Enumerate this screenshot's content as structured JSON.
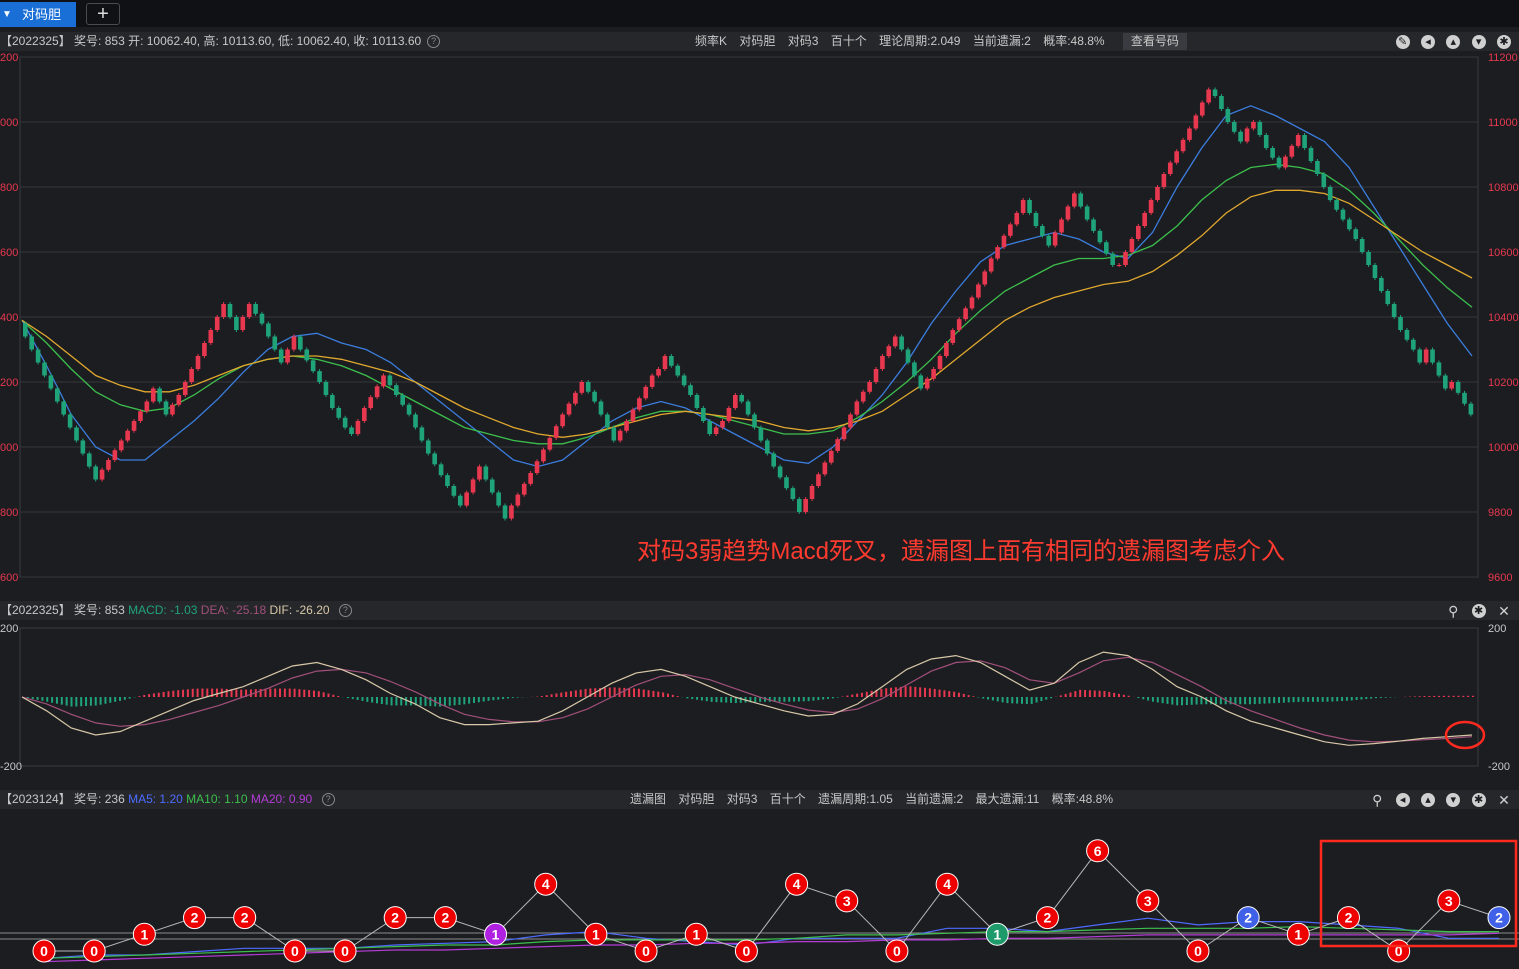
{
  "tabs": {
    "active_label": "对码胆",
    "add_label": "+"
  },
  "main_header": {
    "info": "【2022325】 奖号: 853   开: 10062.40, 高: 10113.60, 低: 10062.40, 收: 10113.60",
    "items": [
      "频率K",
      "对码胆",
      "对码3",
      "百十个",
      "理论周期:2.049",
      "当前遗漏:2",
      "概率:48.8%"
    ],
    "view_button": "查看号码"
  },
  "annotation": "对码3弱趋势Macd死叉，遗漏图上面有相同的遗漏图考虑介入",
  "macd_header": {
    "info": "【2022325】 奖号: 853",
    "macd": "MACD: -1.03",
    "dea": "DEA: -25.18",
    "dif": "DIF: -26.20"
  },
  "omit_header": {
    "info": "【2023124】 奖号: 236",
    "ma5": "MA5: 1.20",
    "ma10": "MA10: 1.10",
    "ma20": "MA20: 0.90",
    "items": [
      "遗漏图",
      "对码胆",
      "对码3",
      "百十个",
      "遗漏周期:1.05",
      "当前遗漏:2",
      "最大遗漏:11",
      "概率:48.8%"
    ]
  },
  "colors": {
    "up": "#e8384f",
    "down": "#1fa47a",
    "ma_fast": "#3b7ddd",
    "ma_mid": "#3cbf4c",
    "ma_slow": "#e0a82e",
    "dif": "#d8c8a8",
    "dea": "#a0507a",
    "note": "#ff3b2f"
  },
  "chart_data": [
    {
      "type": "candlestick",
      "title": "",
      "ylim": [
        9600,
        11200
      ],
      "yticks_right": [
        "11200",
        "11000",
        "10800",
        "10600",
        "10400",
        "10200",
        "10000",
        "9800",
        "9600"
      ],
      "yticks_left": [
        "200",
        "000",
        "800",
        "600",
        "400",
        "200",
        "000",
        "800",
        "600"
      ],
      "ohlc_last": {
        "open": 10062.4,
        "high": 10113.6,
        "low": 10062.4,
        "close": 10113.6
      },
      "brick": 40,
      "path": [
        10380,
        10300,
        10180,
        10060,
        9940,
        9900,
        9960,
        10020,
        10080,
        10140,
        10180,
        10100,
        10160,
        10240,
        10320,
        10400,
        10440,
        10360,
        10400,
        10440,
        10380,
        10300,
        10260,
        10340,
        10300,
        10200,
        10120,
        10060,
        10040,
        10120,
        10220,
        10160,
        10100,
        9980,
        9880,
        9820,
        9860,
        9940,
        9900,
        9780,
        9820,
        9920,
        10100,
        10200,
        10140,
        10020,
        10080,
        10220,
        10240,
        10280,
        10220,
        10160,
        10080,
        10040,
        10060,
        10080,
        10160,
        10140,
        10060,
        9940,
        9840,
        9800,
        9880,
        10060,
        10140,
        10200,
        10280,
        10340,
        10300,
        10180,
        10240,
        10360,
        10460,
        10580,
        10720,
        10760,
        10680,
        10620,
        10740,
        10780,
        10700,
        10560,
        10560,
        10640,
        10840,
        10980,
        11060,
        11100,
        11080,
        11000,
        10940,
        10980,
        11000,
        10920,
        10860,
        10960,
        10920,
        10840,
        10760,
        10700,
        10640,
        10560,
        10440,
        10360,
        10300,
        10260,
        10300,
        10260,
        10220,
        10180,
        10200,
        10100
      ],
      "series": [
        {
          "name": "",
          "color": "#3b7ddd",
          "values": [
            10390,
            10250,
            10100,
            10000,
            9960,
            9960,
            10020,
            10080,
            10150,
            10230,
            10300,
            10340,
            10350,
            10320,
            10300,
            10260,
            10200,
            10140,
            10080,
            10020,
            9960,
            9940,
            9960,
            10020,
            10080,
            10120,
            10140,
            10120,
            10080,
            10040,
            10000,
            9960,
            9950,
            10000,
            10080,
            10160,
            10260,
            10380,
            10480,
            10570,
            10620,
            10640,
            10660,
            10640,
            10600,
            10580,
            10660,
            10800,
            10920,
            11020,
            11050,
            11020,
            10980,
            10940,
            10860,
            10740,
            10620,
            10500,
            10380,
            10280
          ]
        },
        {
          "name": "",
          "color": "#3cbf4c",
          "values": [
            10390,
            10320,
            10240,
            10170,
            10130,
            10110,
            10120,
            10160,
            10210,
            10250,
            10270,
            10280,
            10270,
            10250,
            10220,
            10180,
            10140,
            10100,
            10060,
            10040,
            10020,
            10010,
            10010,
            10030,
            10060,
            10090,
            10110,
            10110,
            10100,
            10080,
            10060,
            10040,
            10040,
            10050,
            10090,
            10140,
            10200,
            10270,
            10350,
            10420,
            10480,
            10520,
            10560,
            10580,
            10580,
            10590,
            10620,
            10680,
            10760,
            10820,
            10860,
            10870,
            10860,
            10840,
            10790,
            10720,
            10640,
            10560,
            10490,
            10430
          ]
        },
        {
          "name": "",
          "color": "#e0a82e",
          "values": [
            10390,
            10340,
            10280,
            10220,
            10190,
            10170,
            10170,
            10190,
            10220,
            10250,
            10270,
            10280,
            10280,
            10270,
            10250,
            10230,
            10200,
            10160,
            10120,
            10090,
            10060,
            10040,
            10030,
            10040,
            10060,
            10080,
            10100,
            10110,
            10100,
            10090,
            10080,
            10060,
            10050,
            10060,
            10080,
            10110,
            10160,
            10210,
            10270,
            10330,
            10390,
            10430,
            10460,
            10480,
            10500,
            10510,
            10540,
            10590,
            10650,
            10720,
            10770,
            10790,
            10790,
            10780,
            10750,
            10700,
            10650,
            10600,
            10560,
            10520
          ]
        }
      ]
    },
    {
      "type": "bar+line",
      "title": "MACD",
      "ylim": [
        -200,
        200
      ],
      "yticks_right": [
        "200",
        "-200"
      ],
      "yticks_left": [
        "200",
        "-200"
      ],
      "series": [
        {
          "name": "DIF",
          "color": "#d8c8a8",
          "values": [
            0,
            -40,
            -90,
            -110,
            -100,
            -70,
            -40,
            -10,
            10,
            30,
            60,
            90,
            100,
            80,
            50,
            10,
            -20,
            -60,
            -80,
            -80,
            -75,
            -70,
            -40,
            0,
            40,
            70,
            80,
            60,
            30,
            0,
            -20,
            -40,
            -55,
            -50,
            -20,
            30,
            80,
            110,
            120,
            100,
            60,
            20,
            40,
            100,
            130,
            120,
            80,
            30,
            0,
            -40,
            -70,
            -90,
            -110,
            -130,
            -140,
            -135,
            -128,
            -120,
            -115,
            -110
          ]
        },
        {
          "name": "DEA",
          "color": "#a0507a",
          "values": [
            0,
            -20,
            -50,
            -75,
            -85,
            -80,
            -65,
            -45,
            -25,
            0,
            25,
            55,
            75,
            80,
            70,
            45,
            15,
            -20,
            -50,
            -65,
            -72,
            -72,
            -60,
            -35,
            0,
            35,
            60,
            65,
            50,
            25,
            0,
            -20,
            -38,
            -45,
            -35,
            -5,
            35,
            75,
            100,
            105,
            85,
            50,
            40,
            70,
            105,
            115,
            100,
            65,
            30,
            -10,
            -40,
            -65,
            -90,
            -110,
            -125,
            -130,
            -128,
            -124,
            -120,
            -115
          ]
        }
      ],
      "note": "histogram = 2*(DIF-DEA)"
    },
    {
      "type": "line",
      "title": "遗漏图",
      "points": [
        {
          "x": 1,
          "y": 0,
          "color": "red"
        },
        {
          "x": 2,
          "y": 0,
          "color": "red"
        },
        {
          "x": 3,
          "y": 1,
          "color": "red"
        },
        {
          "x": 4,
          "y": 2,
          "color": "red"
        },
        {
          "x": 5,
          "y": 2,
          "color": "red"
        },
        {
          "x": 6,
          "y": 0,
          "color": "red"
        },
        {
          "x": 7,
          "y": 0,
          "color": "red"
        },
        {
          "x": 8,
          "y": 2,
          "color": "red"
        },
        {
          "x": 9,
          "y": 2,
          "color": "red"
        },
        {
          "x": 10,
          "y": 1,
          "color": "purple"
        },
        {
          "x": 11,
          "y": 4,
          "color": "red"
        },
        {
          "x": 12,
          "y": 1,
          "color": "red"
        },
        {
          "x": 13,
          "y": 0,
          "color": "red"
        },
        {
          "x": 14,
          "y": 1,
          "color": "red"
        },
        {
          "x": 15,
          "y": 0,
          "color": "red"
        },
        {
          "x": 16,
          "y": 4,
          "color": "red"
        },
        {
          "x": 17,
          "y": 3,
          "color": "red"
        },
        {
          "x": 18,
          "y": 0,
          "color": "red"
        },
        {
          "x": 19,
          "y": 4,
          "color": "red"
        },
        {
          "x": 20,
          "y": 1,
          "color": "green"
        },
        {
          "x": 21,
          "y": 2,
          "color": "red"
        },
        {
          "x": 22,
          "y": 6,
          "color": "red"
        },
        {
          "x": 23,
          "y": 3,
          "color": "red"
        },
        {
          "x": 24,
          "y": 0,
          "color": "red"
        },
        {
          "x": 25,
          "y": 2,
          "color": "blue"
        },
        {
          "x": 26,
          "y": 1,
          "color": "red"
        },
        {
          "x": 27,
          "y": 2,
          "color": "red"
        },
        {
          "x": 28,
          "y": 0,
          "color": "red"
        },
        {
          "x": 29,
          "y": 3,
          "color": "red"
        },
        {
          "x": 30,
          "y": 2,
          "color": "blue"
        }
      ],
      "ma_series": [
        {
          "name": "MA5",
          "color": "#4d6cff",
          "values": [
            0.4,
            0.6,
            0.6,
            0.8,
            1.0,
            1.0,
            1.0,
            1.2,
            1.3,
            1.4,
            1.8,
            2.0,
            1.6,
            1.4,
            1.2,
            1.6,
            1.6,
            1.6,
            2.2,
            2.2,
            2.0,
            2.4,
            2.8,
            2.4,
            2.6,
            2.6,
            2.4,
            2.2,
            1.6,
            1.6
          ]
        },
        {
          "name": "MA10",
          "color": "#3cbf4c",
          "values": [
            0.4,
            0.5,
            0.6,
            0.7,
            0.8,
            0.9,
            1.0,
            1.1,
            1.2,
            1.2,
            1.4,
            1.5,
            1.5,
            1.5,
            1.5,
            1.6,
            1.8,
            1.8,
            1.9,
            2.0,
            2.0,
            2.1,
            2.2,
            2.2,
            2.2,
            2.3,
            2.2,
            2.1,
            2.0,
            2.0
          ]
        },
        {
          "name": "MA20",
          "color": "#b43cd6",
          "values": [
            0.2,
            0.3,
            0.4,
            0.5,
            0.6,
            0.7,
            0.8,
            0.9,
            0.9,
            1.0,
            1.1,
            1.2,
            1.2,
            1.3,
            1.3,
            1.4,
            1.4,
            1.5,
            1.5,
            1.6,
            1.6,
            1.7,
            1.8,
            1.8,
            1.8,
            1.8,
            1.8,
            1.8,
            1.8,
            1.9
          ]
        }
      ]
    }
  ]
}
